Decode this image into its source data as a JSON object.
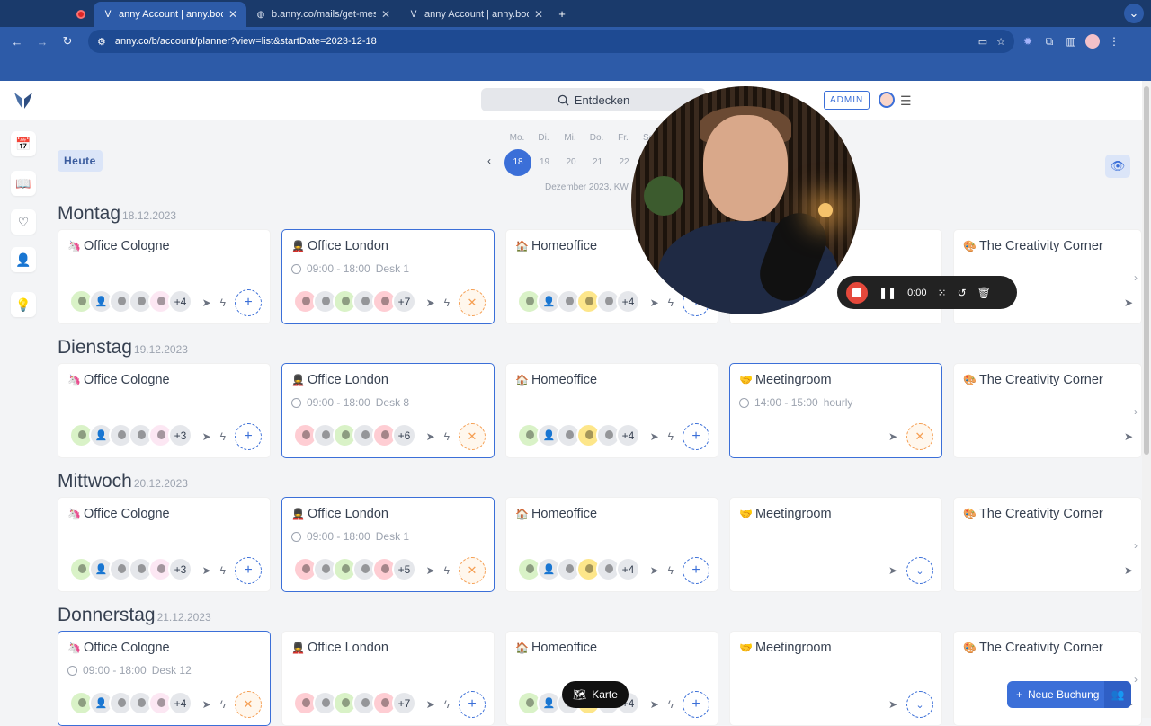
{
  "browser": {
    "tabs": [
      {
        "title": "",
        "icon": "record-icon",
        "active": false
      },
      {
        "title": "anny Account | anny.book",
        "icon": "anny-logo-icon",
        "active": true
      },
      {
        "title": "b.anny.co/mails/get-message",
        "icon": "globe-icon",
        "active": false
      },
      {
        "title": "anny Account | anny.booking",
        "icon": "anny-logo-icon",
        "active": false
      }
    ],
    "url": "anny.co/b/account/planner?view=list&startDate=2023-12-18"
  },
  "topbar": {
    "search_label": "Entdecken",
    "admin_label": "ADMIN"
  },
  "toolbar": {
    "today_label": "Heute"
  },
  "week": {
    "weekdays": [
      "Mo.",
      "Di.",
      "Mi.",
      "Do.",
      "Fr.",
      "Sa."
    ],
    "dates": [
      "18",
      "19",
      "20",
      "21",
      "22",
      ""
    ],
    "selected_index": 0,
    "label": "Dezember 2023, KW"
  },
  "days": [
    {
      "name": "Montag",
      "date": "18.12.2023"
    },
    {
      "name": "Dienstag",
      "date": "19.12.2023"
    },
    {
      "name": "Mittwoch",
      "date": "20.12.2023"
    },
    {
      "name": "Donnerstag",
      "date": "21.12.2023"
    }
  ],
  "cards": [
    [
      {
        "title": "Office Cologne",
        "emoji": "🦄",
        "time": "",
        "desk": "",
        "more": "+4",
        "selected": false,
        "action": "add"
      },
      {
        "title": "Office London",
        "emoji": "💂",
        "time": "09:00 - 18:00",
        "desk": "Desk 1",
        "more": "+7",
        "selected": true,
        "action": "cancel"
      },
      {
        "title": "Homeoffice",
        "emoji": "🏠",
        "time": "",
        "desk": "",
        "more": "+4",
        "selected": false,
        "action": "add"
      },
      {
        "title": "",
        "emoji": "",
        "time": "",
        "desk": "",
        "more": "",
        "selected": false,
        "action": "add"
      },
      {
        "title": "The Creativity Corner",
        "emoji": "🎨",
        "time": "",
        "desk": "",
        "more": "",
        "selected": false,
        "action": "none"
      }
    ],
    [
      {
        "title": "Office Cologne",
        "emoji": "🦄",
        "time": "",
        "desk": "",
        "more": "+3",
        "selected": false,
        "action": "add"
      },
      {
        "title": "Office London",
        "emoji": "💂",
        "time": "09:00 - 18:00",
        "desk": "Desk 8",
        "more": "+6",
        "selected": true,
        "action": "cancel"
      },
      {
        "title": "Homeoffice",
        "emoji": "🏠",
        "time": "",
        "desk": "",
        "more": "+4",
        "selected": false,
        "action": "add"
      },
      {
        "title": "Meetingroom",
        "emoji": "🤝",
        "time": "14:00 - 15:00",
        "desk": "hourly",
        "more": "",
        "selected": true,
        "action": "cancel"
      },
      {
        "title": "The Creativity Corner",
        "emoji": "🎨",
        "time": "",
        "desk": "",
        "more": "",
        "selected": false,
        "action": "none"
      }
    ],
    [
      {
        "title": "Office Cologne",
        "emoji": "🦄",
        "time": "",
        "desk": "",
        "more": "+3",
        "selected": false,
        "action": "add"
      },
      {
        "title": "Office London",
        "emoji": "💂",
        "time": "09:00 - 18:00",
        "desk": "Desk 1",
        "more": "+5",
        "selected": true,
        "action": "cancel"
      },
      {
        "title": "Homeoffice",
        "emoji": "🏠",
        "time": "",
        "desk": "",
        "more": "+4",
        "selected": false,
        "action": "add"
      },
      {
        "title": "Meetingroom",
        "emoji": "🤝",
        "time": "",
        "desk": "",
        "more": "",
        "selected": false,
        "action": "expand"
      },
      {
        "title": "The Creativity Corner",
        "emoji": "🎨",
        "time": "",
        "desk": "",
        "more": "",
        "selected": false,
        "action": "none"
      }
    ],
    [
      {
        "title": "Office Cologne",
        "emoji": "🦄",
        "time": "09:00 - 18:00",
        "desk": "Desk 12",
        "more": "+4",
        "selected": true,
        "action": "cancel"
      },
      {
        "title": "Office London",
        "emoji": "💂",
        "time": "",
        "desk": "",
        "more": "+7",
        "selected": false,
        "action": "add"
      },
      {
        "title": "Homeoffice",
        "emoji": "🏠",
        "time": "",
        "desk": "",
        "more": "+4",
        "selected": false,
        "action": "add"
      },
      {
        "title": "Meetingroom",
        "emoji": "🤝",
        "time": "",
        "desk": "",
        "more": "",
        "selected": false,
        "action": "expand"
      },
      {
        "title": "The Creativity Corner",
        "emoji": "🎨",
        "time": "",
        "desk": "",
        "more": "",
        "selected": false,
        "action": "none"
      }
    ]
  ],
  "avatar_sets": [
    [
      [
        "#d9f2c7",
        "#fde68a"
      ],
      [
        "person"
      ],
      [
        "#e5e7eb",
        "#374151"
      ],
      [
        "#e5e7eb",
        "#6b7280"
      ],
      [
        "#fce7f3",
        "#111827"
      ]
    ],
    [
      [
        "#fecdd3",
        "#9f6b4e"
      ],
      [
        "#e5e7eb",
        "#374151"
      ],
      [
        "#d9f2c7",
        "#111827"
      ],
      [
        "#e5e7eb",
        "#6b7280"
      ],
      [
        "#fecdd3",
        "#b45309"
      ]
    ],
    [
      [
        "#d9f2c7",
        "#fde68a"
      ],
      [
        "person"
      ],
      [
        "#e5e7eb",
        "#111827"
      ],
      [
        "#fde68a",
        "#6b7280"
      ],
      [
        "#e5e7eb",
        "#b45309"
      ]
    ],
    [],
    []
  ],
  "recorder": {
    "time": "0:00"
  },
  "floating": {
    "map_label": "Karte",
    "new_booking_label": "Neue Buchung"
  }
}
